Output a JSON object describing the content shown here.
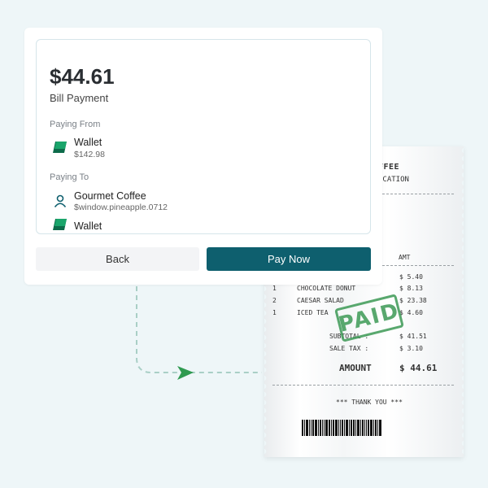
{
  "payment": {
    "amount": "$44.61",
    "title": "Bill Payment",
    "paying_from_label": "Paying From",
    "from_name": "Wallet",
    "from_balance": "$142.98",
    "paying_to_label": "Paying To",
    "to_name": "Gourmet Coffee",
    "to_handle": "$window.pineapple.0712",
    "to_method": "Wallet",
    "back_label": "Back",
    "pay_label": "Pay Now",
    "wallet_icon": "wallet-icon",
    "person_icon": "person-icon",
    "accent_color": "#0e5f6e",
    "wallet_colors": [
      "#1aa56b",
      "#0d6b4a"
    ]
  },
  "receipt": {
    "store": "FFEE",
    "location": "OCATION",
    "amt_header": "AMT",
    "first_price": "$ 5.40",
    "items": [
      {
        "qty": "1",
        "name": "CHOCOLATE DONUT",
        "price": "$ 8.13"
      },
      {
        "qty": "2",
        "name": "CAESAR SALAD",
        "price": "$ 23.38"
      },
      {
        "qty": "1",
        "name": "ICED TEA",
        "price": "$ 4.60"
      }
    ],
    "subtotal_label": "SUBTOTAL :",
    "subtotal_value": "$ 41.51",
    "tax_label": "SALE TAX :",
    "tax_value": "$ 3.10",
    "amount_label": "AMOUNT",
    "amount_value": "$ 44.61",
    "thanks": "*** THANK YOU ***",
    "stamp": "PAID",
    "stamp_color": "#3d9a56"
  }
}
